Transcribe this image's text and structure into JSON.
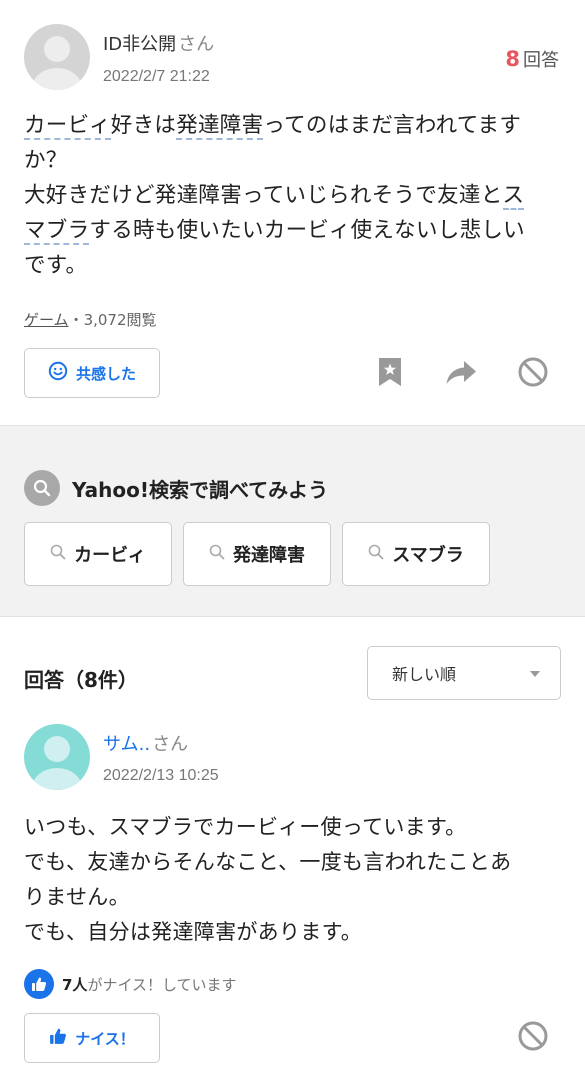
{
  "question": {
    "user_name": "ID非公開",
    "honorific": "さん",
    "date": "2022/2/7 21:22",
    "answer_count": "8",
    "answer_count_unit": "回答",
    "text": {
      "line1_kw1": "カービィ",
      "line1_mid": "好きは",
      "line1_kw2": "発達障害",
      "line1_tail": "ってのはまだ言われてます",
      "line2": "か？",
      "line3_head": "大好きだけど発達障害っていじられそうで友達と",
      "line3_kw": "ス",
      "line4_kw": "マブラ",
      "line4_tail": "する時も使いたいカービィ使えないし悲しい",
      "line5": "です。"
    },
    "category": "ゲーム",
    "views": "・3,072閲覧",
    "empathy_label": "共感した"
  },
  "search": {
    "title": "Yahoo!検索で調べてみよう",
    "chips": [
      "カービィ",
      "発達障害",
      "スマブラ"
    ]
  },
  "answers": {
    "header": "回答（8件）",
    "sort_selected": "新しい順",
    "items": [
      {
        "user_name": "サム..",
        "honorific": "さん",
        "date": "2022/2/13 10:25",
        "lines": [
          "いつも、スマブラでカービィー使っています。",
          "でも、友達からそんなこと、一度も言われたことあ",
          "りません。",
          "でも、自分は発達障害があります。"
        ],
        "nice_count": "7人",
        "nice_suffix": "がナイス！しています",
        "nice_label": "ナイス！"
      }
    ]
  },
  "colors": {
    "accent": "#1a73e8",
    "answer_count": "#e8565f",
    "icon_gray": "#999999"
  },
  "icons": [
    "smile-icon",
    "bookmark-icon",
    "share-icon",
    "block-icon",
    "search-icon",
    "thumbs-up-icon"
  ]
}
